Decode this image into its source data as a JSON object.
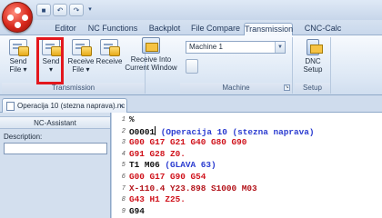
{
  "tabs": [
    "Editor",
    "NC Functions",
    "Backplot",
    "File Compare",
    "Transmission",
    "CNC-Calc"
  ],
  "active_tab": "Transmission",
  "ribbon": {
    "transmission_group": {
      "label": "Transmission",
      "buttons": [
        {
          "line1": "Send",
          "line2": "File ▾"
        },
        {
          "line1": "Send",
          "line2": "▾"
        },
        {
          "line1": "Receive",
          "line2": "File ▾"
        },
        {
          "line1": "Receive",
          "line2": ""
        },
        {
          "line1": "Receive Into",
          "line2": "Current Window"
        }
      ]
    },
    "machine_group": {
      "label": "Machine",
      "machine_select": "Machine 1"
    },
    "setup_group": {
      "label": "Setup",
      "button": {
        "line1": "DNC",
        "line2": "Setup"
      }
    }
  },
  "document_tab": {
    "title": "Operacija 10 (stezna naprava).nc *",
    "close": "×"
  },
  "assistant": {
    "title": "NC-Assistant",
    "description_label": "Description:",
    "description_value": ""
  },
  "editor": {
    "lines": [
      {
        "n": "1",
        "segments": [
          {
            "t": "%",
            "c": "black"
          }
        ]
      },
      {
        "n": "2",
        "segments": [
          {
            "t": "O0001",
            "c": "black"
          },
          {
            "t": " (Operacija 10 (stezna naprava)",
            "c": "blue"
          }
        ]
      },
      {
        "n": "3",
        "segments": [
          {
            "t": "G00 G17 G21 G40 G80 G90",
            "c": "red"
          }
        ]
      },
      {
        "n": "4",
        "segments": [
          {
            "t": "G91 G28 Z0.",
            "c": "red"
          }
        ]
      },
      {
        "n": "5",
        "segments": [
          {
            "t": "T1 M06",
            "c": "black"
          },
          {
            "t": " (GLAVA 63)",
            "c": "blue"
          }
        ]
      },
      {
        "n": "6",
        "segments": [
          {
            "t": "G00 G17 G90 G54",
            "c": "red"
          }
        ]
      },
      {
        "n": "7",
        "segments": [
          {
            "t": "X-110.4 Y23.898 S1000 M03",
            "c": "darkred"
          }
        ]
      },
      {
        "n": "8",
        "segments": [
          {
            "t": "G43 H1 Z25.",
            "c": "red"
          }
        ]
      },
      {
        "n": "9",
        "segments": [
          {
            "t": "G94",
            "c": "black"
          }
        ]
      }
    ]
  },
  "colors": {
    "highlight": "#e3171d",
    "app_orb": "#d8281c"
  }
}
